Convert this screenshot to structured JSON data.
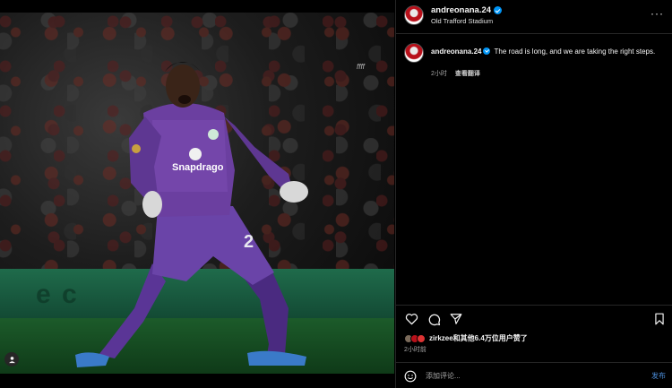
{
  "post": {
    "username": "andreonana.24",
    "location": "Old Trafford Stadium",
    "caption_user": "andreonana.24",
    "caption_text": "The road is long, and we are taking the right steps.",
    "caption_time": "2小时",
    "see_translation": "查看翻译",
    "likes_text": "zirkzee和其他6.4万位用户赞了",
    "post_time": "2小时前",
    "comment_placeholder": "添加评论...",
    "post_button": "发布"
  },
  "media": {
    "board_text": "e c",
    "watermark": "ffff"
  },
  "icons": {
    "more": "more-horizontal-icon",
    "like": "heart-icon",
    "comment": "comment-icon",
    "share": "share-icon",
    "save": "bookmark-icon",
    "emoji": "emoji-icon",
    "tag": "user-tag-icon"
  },
  "colors": {
    "verified": "#0095f6",
    "jersey": "#6b3fa0",
    "post_button": "#4a8bd6"
  }
}
